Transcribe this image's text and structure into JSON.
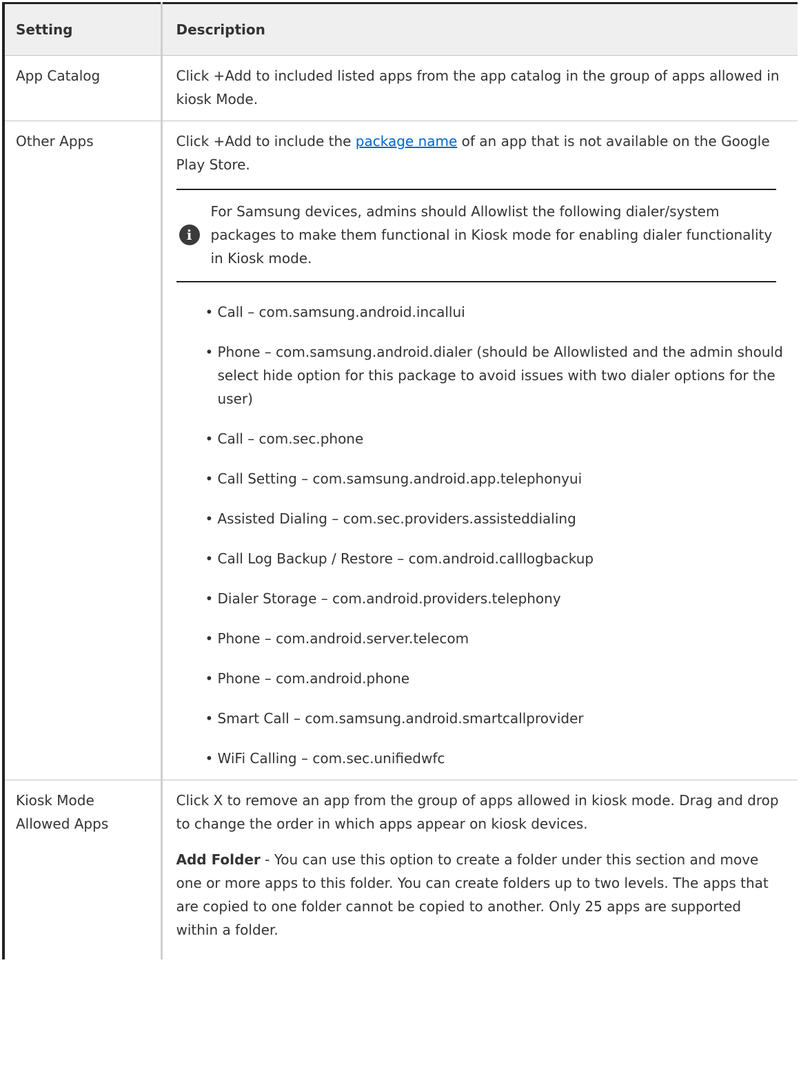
{
  "table": {
    "headers": {
      "setting": "Setting",
      "description": "Description"
    },
    "rows": {
      "app_catalog": {
        "setting": "App Catalog",
        "description": "Click +Add to included listed apps from the app catalog in the group of apps allowed in kiosk Mode."
      },
      "other_apps": {
        "setting": "Other Apps",
        "desc_before_link": "Click +Add to include the ",
        "link_text": "package name",
        "desc_after_link": " of an app that is not available on the Google Play Store.",
        "note_icon": "info-icon",
        "note_text": "For Samsung devices, admins should Allowlist the following dialer/system packages to make them functional in Kiosk mode for enabling dialer functionality in Kiosk mode.",
        "bullet": "•",
        "packages": [
          "Call – com.samsung.android.incallui",
          "Phone – com.samsung.android.dialer (should be Allowlisted and the admin should select hide option for this package to avoid issues with two dialer options for the user)",
          "Call – com.sec.phone",
          "Call Setting – com.samsung.android.app.telephonyui",
          "Assisted Dialing – com.sec.providers.assisteddialing",
          "Call Log Backup / Restore – com.android.calllogbackup",
          "Dialer Storage – com.android.providers.telephony",
          "Phone – com.android.server.telecom",
          "Phone – com.android.phone",
          "Smart Call – com.samsung.android.smartcallprovider",
          "WiFi Calling – com.sec.unifiedwfc"
        ]
      },
      "kiosk_allowed": {
        "setting": "Kiosk Mode Allowed Apps",
        "description": "Click X to remove an app from the group of apps allowed in kiosk mode. Drag and drop to change the order in which apps appear on kiosk devices.",
        "add_folder_label": "Add Folder",
        "add_folder_text": " - You can use this option to create a folder under this section and move one or more apps to this folder. You can create folders up to two levels. The apps that are copied to one folder cannot be copied to another. Only 25 apps are supported within a folder."
      }
    }
  },
  "colors": {
    "header_bg": "#efefef",
    "link": "#0066cc",
    "text": "#333333",
    "rule": "#222222"
  }
}
